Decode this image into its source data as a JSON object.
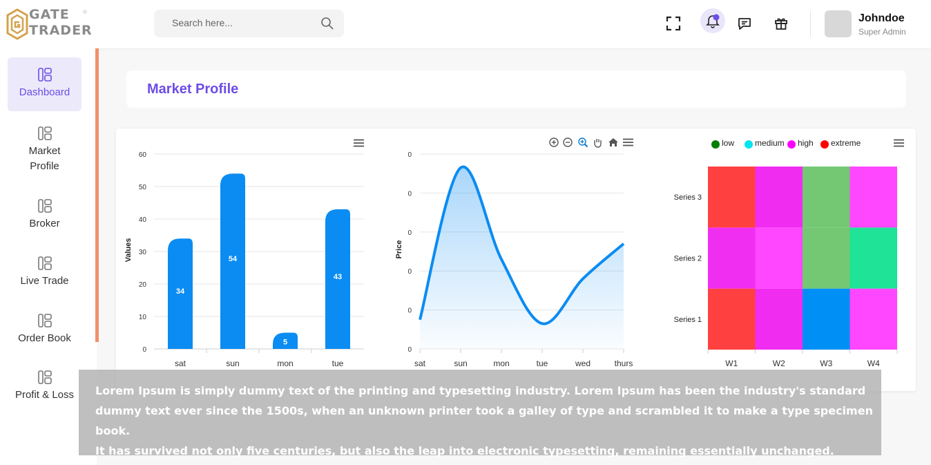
{
  "brand": {
    "line1": "GATE",
    "line2": "TRADER",
    "mark": "®"
  },
  "search": {
    "placeholder": "Search here..."
  },
  "user": {
    "name": "Johndoe",
    "role": "Super Admin"
  },
  "sidebar": {
    "items": [
      {
        "label": "Dashboard",
        "active": true
      },
      {
        "label": "Market Profile",
        "active": false
      },
      {
        "label": "Broker",
        "active": false
      },
      {
        "label": "Live Trade",
        "active": false
      },
      {
        "label": "Order Book",
        "active": false
      },
      {
        "label": "Profit & Loss",
        "active": false
      }
    ]
  },
  "page": {
    "title": "Market Profile"
  },
  "icons": {
    "fullscreen": "fullscreen-icon",
    "notifications": "bell-icon",
    "messages": "chat-icon",
    "gifts": "gift-icon",
    "search": "search-icon",
    "menu": "hamburger-icon",
    "zoom_in": "zoom-in-icon",
    "zoom_out": "zoom-out-icon",
    "zoom": "magnifier-icon",
    "pan": "hand-icon",
    "home": "home-icon"
  },
  "colors": {
    "accent": "#6c4de6",
    "bar": "#0b8cf2",
    "line": "#0b8cf2",
    "sidebar_accent": "#f0906a"
  },
  "chart_data": [
    {
      "type": "bar",
      "categories": [
        "sat",
        "sun",
        "mon",
        "tue"
      ],
      "values": [
        34,
        54,
        5,
        43
      ],
      "ylabel": "Values",
      "ylim": [
        0,
        60
      ],
      "yticks": [
        0,
        10,
        20,
        30,
        40,
        50,
        60
      ]
    },
    {
      "type": "area",
      "x": [
        "sat",
        "sun",
        "mon",
        "tue",
        "wed",
        "thurs"
      ],
      "ylabel": "Price",
      "yticks": [
        "0",
        "0",
        "0",
        "0",
        "0",
        "0"
      ],
      "series": [
        {
          "values": [
            0.15,
            0.93,
            0.46,
            0.13,
            0.36,
            0.54
          ]
        }
      ],
      "ylim": [
        0,
        1
      ]
    },
    {
      "type": "heatmap",
      "x": [
        "W1",
        "W2",
        "W3",
        "W4"
      ],
      "y": [
        "Series 1",
        "Series 2",
        "Series 3"
      ],
      "legend": [
        {
          "label": "low",
          "color": "#008000"
        },
        {
          "label": "medium",
          "color": "#00e5ee"
        },
        {
          "label": "high",
          "color": "#ff00ff"
        },
        {
          "label": "extreme",
          "color": "#ff0000"
        }
      ],
      "cells": [
        [
          "extreme",
          "high",
          "medium",
          "high"
        ],
        [
          "high",
          "high",
          "low",
          "medium"
        ],
        [
          "extreme",
          "high",
          "low",
          "high"
        ]
      ],
      "cell_colors": [
        [
          "#ff4040",
          "#f12cf1",
          "#008ff5",
          "#ff47ff"
        ],
        [
          "#ef2ef2",
          "#ff47ff",
          "#74c874",
          "#1fe396"
        ],
        [
          "#ff4040",
          "#f12cf1",
          "#74c874",
          "#ff47ff"
        ]
      ]
    }
  ],
  "overlay_text": [
    "Lorem Ipsum is simply dummy text of the printing and typesetting industry. Lorem Ipsum has been the industry's standard dummy text ever since the 1500s, when an unknown printer took a galley of type and scrambled it to make a type specimen book.",
    "It has survived not only five centuries, but also the leap into electronic typesetting, remaining essentially unchanged."
  ]
}
